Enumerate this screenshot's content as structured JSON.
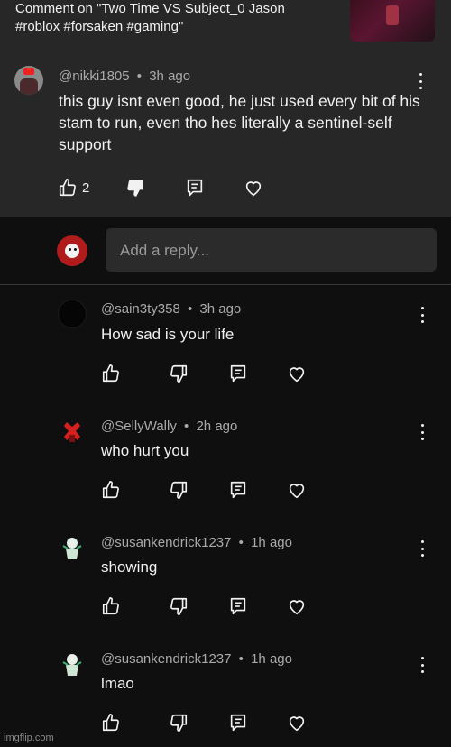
{
  "video": {
    "title_line1": "Comment on \"Two Time VS Subject_0 Jason",
    "title_line2": "#roblox #forsaken #gaming\""
  },
  "main_comment": {
    "author": "@nikki1805",
    "separator": "•",
    "time": "3h ago",
    "text": "this guy isnt even good, he just used every bit of his stam to run, even tho hes literally a sentinel-self support",
    "likes": "2"
  },
  "reply_box": {
    "placeholder": "Add a reply..."
  },
  "replies": [
    {
      "author": "@sain3ty358",
      "separator": "•",
      "time": "3h ago",
      "text": "How sad is your life"
    },
    {
      "author": "@SellyWally",
      "separator": "•",
      "time": "2h ago",
      "text": "who hurt you"
    },
    {
      "author": "@susankendrick1237",
      "separator": "•",
      "time": "1h ago",
      "text": "showing"
    },
    {
      "author": "@susankendrick1237",
      "separator": "•",
      "time": "1h ago",
      "text": "lmao"
    }
  ],
  "icons": [
    "like-icon",
    "dislike-icon",
    "reply-icon",
    "heart-icon",
    "more-options-icon"
  ],
  "colors": {
    "background": "#0f0f0f",
    "card": "#272727",
    "text": "#f1f1f1",
    "muted": "#aaaaaa"
  },
  "watermark": "imgflip.com"
}
